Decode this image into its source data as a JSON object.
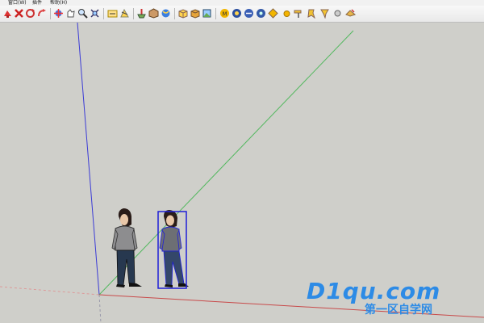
{
  "menu": {
    "items": [
      {
        "label": "窗口(W)"
      },
      {
        "label": "插件"
      },
      {
        "label": "帮助(H)"
      }
    ]
  },
  "toolbar": {
    "icons": [
      "section-plane-icon",
      "cut-icon",
      "rotate-icon",
      "undo-icon",
      "orbit-icon",
      "pan-icon",
      "zoom-icon",
      "zoom-extents-icon",
      "dimensions-icon",
      "3d-warehouse-icon",
      "share-model-icon",
      "components-icon",
      "materials-icon",
      "styles-icon",
      "layers-icon",
      "scenes-icon",
      "shadows-icon",
      "fog-icon",
      "match-photo-icon",
      "soften-edges-icon",
      "geo-location-icon",
      "sun-icon",
      "paint-icon",
      "sandbox-icon",
      "component-icon",
      "outliner-icon"
    ]
  },
  "viewport": {
    "axis_colors": {
      "blue": "#3b3bd6",
      "green": "#53b85f",
      "red": "#c84a4a"
    },
    "selection_color": "#1f1fd8",
    "figures": [
      {
        "name": "person-figure",
        "selected": false
      },
      {
        "name": "person-figure-selected",
        "selected": true
      }
    ]
  },
  "watermark": {
    "main": "D1qu.com",
    "sub": "第一区自学网",
    "color": "#2d8be6"
  }
}
